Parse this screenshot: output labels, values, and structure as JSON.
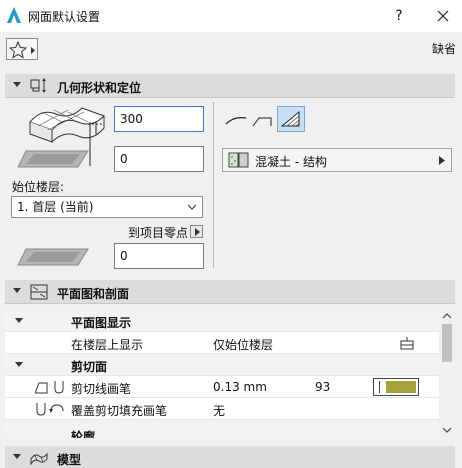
{
  "window": {
    "title": "网面默认设置",
    "help_label": "?"
  },
  "toolbar": {
    "default_label": "缺省"
  },
  "geometry": {
    "title": "几何形状和定位",
    "thickness_value": "300",
    "offset_value": "0",
    "home_story_label": "始位楼层:",
    "home_story_value": "1. 首层 (当前)",
    "project_zero_label": "到项目零点",
    "project_zero_value": "0",
    "material_name": "混凝土 - 结构"
  },
  "floorplan": {
    "title": "平面图和剖面",
    "rows": [
      {
        "label": "平面图显示",
        "type": "group"
      },
      {
        "label": "在楼层上显示",
        "value": "仅始位楼层"
      },
      {
        "label": "剪切面",
        "type": "group"
      },
      {
        "label": "剪切线画笔",
        "value": "0.13 mm",
        "number": "93"
      },
      {
        "label": "覆盖剪切填充画笔",
        "value": "无"
      },
      {
        "label": "轮廓"
      }
    ],
    "pen_color": "#a5a23a"
  },
  "model": {
    "title": "模型"
  }
}
